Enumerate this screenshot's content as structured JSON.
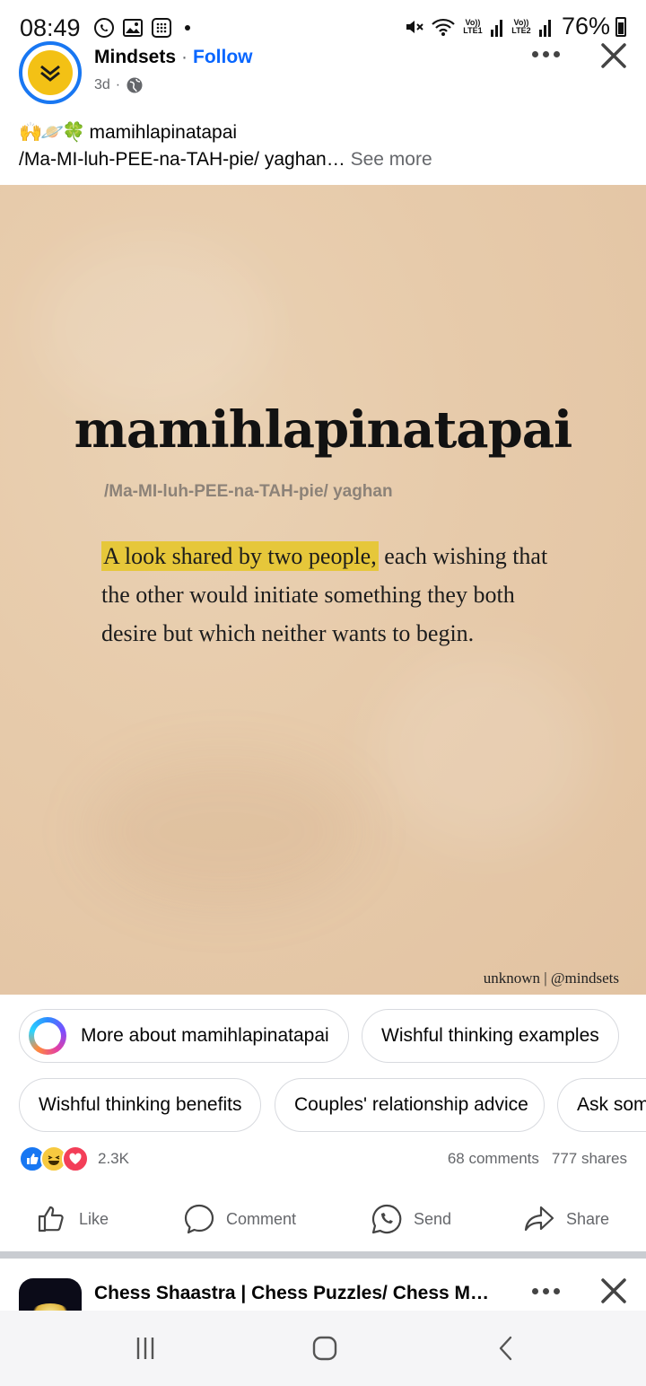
{
  "status_bar": {
    "time": "08:49",
    "battery": "76%",
    "sim1": "Vo)) LTE1",
    "sim2": "Vo)) LTE2"
  },
  "post": {
    "page_name": "Mindsets",
    "follow_label": "Follow",
    "age": "3d",
    "caption_emoji": "🙌🪐🍀",
    "caption_line1": "mamihlapinatapai",
    "caption_line2": "/Ma-MI-luh-PEE-na-TAH-pie/ yaghan…",
    "see_more": "See more",
    "image": {
      "word": "mamihlapinatapai",
      "pronunciation": "/Ma-MI-luh-PEE-na-TAH-pie/ yaghan",
      "definition_highlight": "A look shared by two people,",
      "definition_rest": " each wishing that the other would initiate something they both desire but which neither wants to begin.",
      "credit": "unknown | @mindsets"
    }
  },
  "suggestions": [
    "More about mamihlapinatapai",
    "Wishful thinking examples",
    "Wishful thinking benefits",
    "Couples' relationship advice",
    "Ask som"
  ],
  "engagement": {
    "reactions_count": "2.3K",
    "comments": "68 comments",
    "shares": "777 shares"
  },
  "actions": {
    "like": "Like",
    "comment": "Comment",
    "send": "Send",
    "share": "Share"
  },
  "next_post": {
    "title": "Chess Shaastra | Chess Puzzles/ Chess Me…"
  },
  "colors": {
    "brand_blue": "#1877f2",
    "follow_blue": "#0866ff",
    "highlight_yellow": "#e6c73a",
    "image_bg": "#e7cbab"
  }
}
